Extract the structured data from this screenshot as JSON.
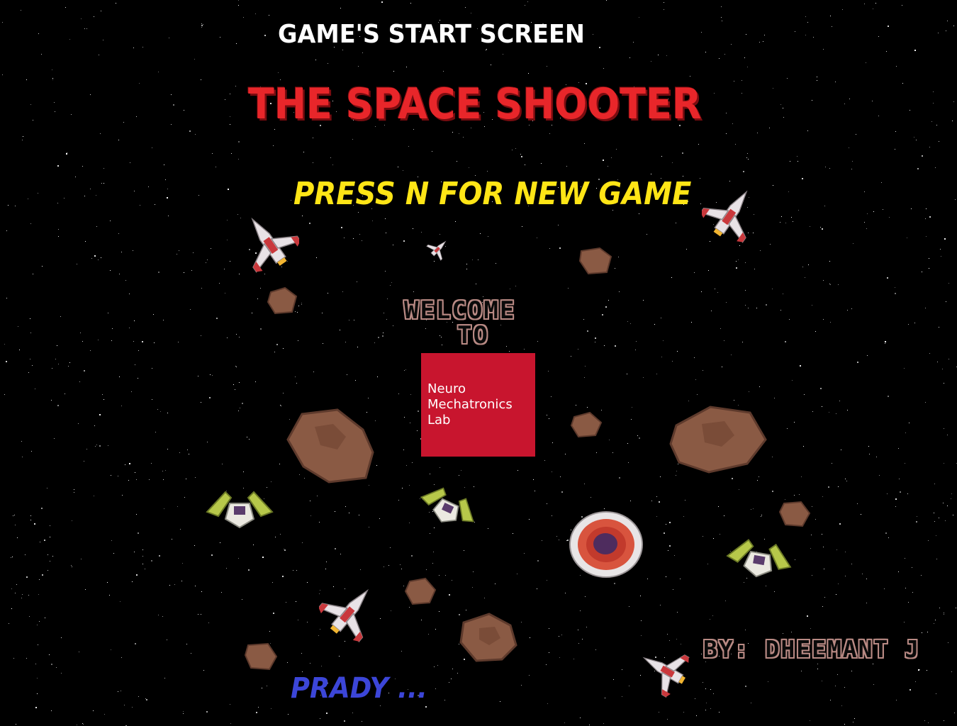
{
  "screen_caption": "GAME'S START SCREEN",
  "title": "THE SPACE SHOOTER",
  "prompt": "PRESS N FOR NEW GAME",
  "welcome": {
    "line1": "WELCOME",
    "line2": "TO"
  },
  "lab_logo": {
    "line1": "Neuro",
    "line2": "Mechatronics",
    "line3": "Lab",
    "color": "#c8152e"
  },
  "credits": {
    "author": "BY: DHEEMANT J",
    "coauthor": "PRADY ..."
  },
  "colors": {
    "background": "#000000",
    "title": "#e8262a",
    "prompt": "#ffe516",
    "coauthor": "#3c46d8",
    "fighter_body": "#e8e2e6",
    "fighter_stripe": "#c9383c",
    "asteroid": "#8a5a44",
    "alien_wing": "#b7c84a"
  },
  "sprite_icons": [
    "red-fighter-ship-icon",
    "asteroid-icon",
    "alien-fighter-icon",
    "shield-powerup-icon"
  ]
}
